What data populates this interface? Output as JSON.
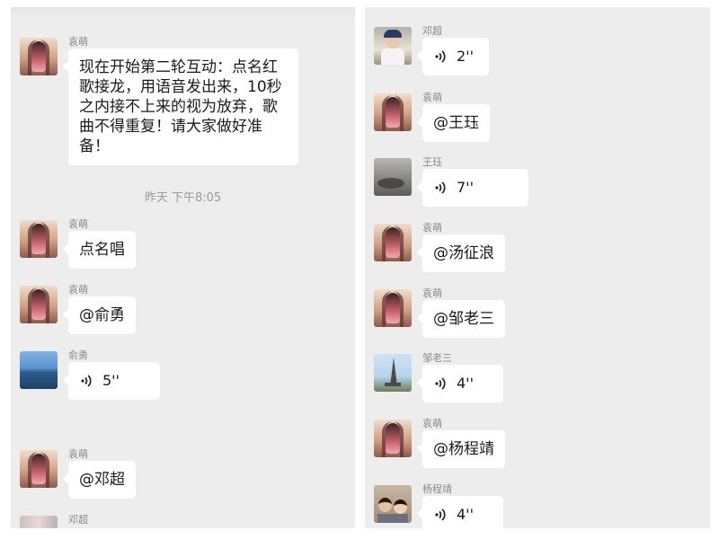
{
  "left_panel": {
    "messages": [
      {
        "sender": "袁萌",
        "text": "现在开始第二轮互动：点名红歌接龙，用语音发出来，10秒之内接不上来的视为放弃，歌曲不得重复！请大家做好准备！"
      },
      {
        "sender": "袁萌",
        "text": "点名唱"
      },
      {
        "sender": "袁萌",
        "text": "@俞勇"
      },
      {
        "sender": "俞勇",
        "voice_duration": "5''"
      },
      {
        "sender": "袁萌",
        "text": "@邓超"
      },
      {
        "sender": "邓超"
      }
    ],
    "timestamp": "昨天 下午8:05"
  },
  "right_panel": {
    "messages": [
      {
        "sender": "邓超",
        "voice_duration": "2''"
      },
      {
        "sender": "袁萌",
        "text": "@王珏"
      },
      {
        "sender": "王珏",
        "voice_duration": "7''"
      },
      {
        "sender": "袁萌",
        "text": "@汤征浪"
      },
      {
        "sender": "袁萌",
        "text": "@邹老三"
      },
      {
        "sender": "邹老三",
        "voice_duration": "4''"
      },
      {
        "sender": "袁萌",
        "text": "@杨程靖"
      },
      {
        "sender": "杨程靖",
        "voice_duration": "4''"
      }
    ]
  },
  "icons": {
    "voice": "voice-wave-icon"
  },
  "colors": {
    "chat_background": "#ededed",
    "bubble": "#ffffff",
    "sender_name": "#8a8a8a",
    "timestamp": "#9a9a9a"
  }
}
